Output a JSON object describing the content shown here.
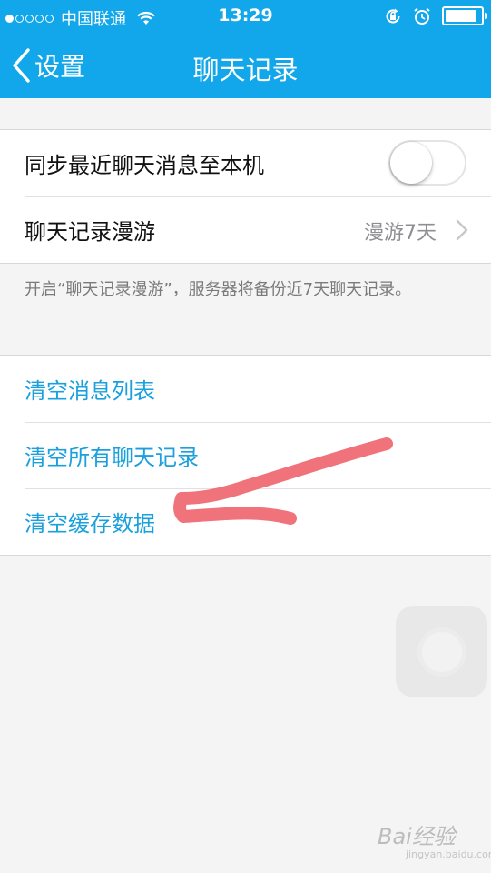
{
  "status_bar": {
    "carrier": "中国联通",
    "time": "13:29",
    "battery_level": 0.9
  },
  "nav": {
    "back_label": "设置",
    "title": "聊天记录"
  },
  "settings": {
    "sync_label": "同步最近聊天消息至本机",
    "sync_enabled": false,
    "roaming_label": "聊天记录漫游",
    "roaming_value": "漫游7天",
    "roaming_footnote": "开启“聊天记录漫游”，服务器将备份近7天聊天记录。"
  },
  "actions": {
    "clear_message_list": "清空消息列表",
    "clear_all_chat_records": "清空所有聊天记录",
    "clear_cache_data": "清空缓存数据"
  },
  "watermark": {
    "brand": "Bai经验",
    "sub": "jingyan.baidu.com"
  },
  "colors": {
    "header": "#12a6ea",
    "action_text": "#1aa0dd",
    "annotation": "#f0727a"
  }
}
